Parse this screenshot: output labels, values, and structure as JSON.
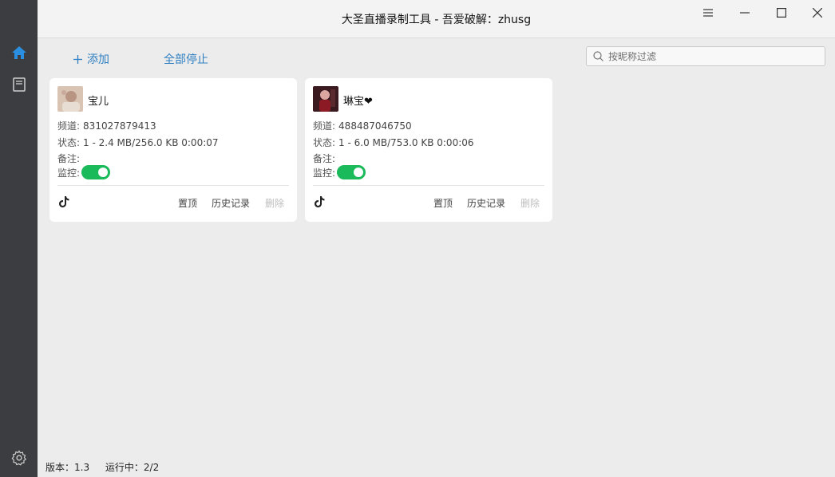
{
  "window": {
    "title": "大圣直播录制工具 - 吾爱破解：zhusg"
  },
  "toolbar": {
    "add_label": "添加",
    "stop_all_label": "全部停止"
  },
  "search": {
    "placeholder": "按昵称过滤"
  },
  "cards": [
    {
      "name": "宝儿",
      "channel_label": "频道:",
      "channel": "831027879413",
      "status_label": "状态:",
      "status": "1 - 2.4 MB/256.0 KB 0:00:07",
      "note_label": "备注:",
      "monitor_label": "监控:",
      "monitor_on": true,
      "platform_icon": "tiktok-icon",
      "pin_label": "置顶",
      "history_label": "历史记录",
      "delete_label": "删除"
    },
    {
      "name": "琳宝❤",
      "channel_label": "频道:",
      "channel": "488487046750",
      "status_label": "状态:",
      "status": "1 - 6.0 MB/753.0 KB 0:00:06",
      "note_label": "备注:",
      "monitor_label": "监控:",
      "monitor_on": true,
      "platform_icon": "tiktok-icon",
      "pin_label": "置顶",
      "history_label": "历史记录",
      "delete_label": "删除"
    }
  ],
  "statusbar": {
    "version": "版本：1.3",
    "running": "运行中：2/2"
  },
  "colors": {
    "accent": "#2f7fc1",
    "toggle_on": "#1aba5a",
    "sidebar": "#3b3d40",
    "active_icon": "#2a8fe0"
  }
}
